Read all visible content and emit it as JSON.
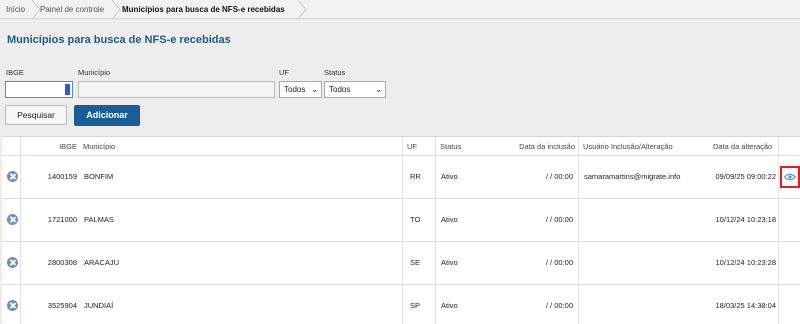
{
  "breadcrumb": {
    "items": [
      "Início",
      "Painel de controle",
      "Municípios para busca de NFS-e recebidas"
    ]
  },
  "page_title": "Municípios para busca de NFS-e recebidas",
  "filters": {
    "ibge_label": "IBGE",
    "ibge_value": "",
    "municipio_label": "Município",
    "municipio_value": "",
    "uf_label": "UF",
    "uf_selected": "Todos",
    "status_label": "Status",
    "status_selected": "Todos"
  },
  "actions": {
    "search_label": "Pesquisar",
    "add_label": "Adicionar"
  },
  "table": {
    "headers": {
      "ibge": "IBGE",
      "municipio": "Município",
      "uf": "UF",
      "status": "Status",
      "inclusao": "Data da inclusão",
      "usuario": "Usuário Inclusão/Alteração",
      "alteracao": "Data da alteração"
    },
    "rows": [
      {
        "ibge": "1400159",
        "municipio": "BONFIM",
        "uf": "RR",
        "status": "Ativo",
        "inclusao": "/ / 00:00",
        "usuario": "samaramartins@migrate.info",
        "alteracao": "09/09/25 09:00:22"
      },
      {
        "ibge": "1721000",
        "municipio": "PALMAS",
        "uf": "TO",
        "status": "Ativo",
        "inclusao": "/ / 00:00",
        "usuario": "",
        "alteracao": "10/12/24 10:23:18"
      },
      {
        "ibge": "2800308",
        "municipio": "ARACAJU",
        "uf": "SE",
        "status": "Ativo",
        "inclusao": "/ / 00:00",
        "usuario": "",
        "alteracao": "10/12/24 10:23:28"
      },
      {
        "ibge": "3525904",
        "municipio": "JUNDIAÍ",
        "uf": "SP",
        "status": "Ativo",
        "inclusao": "/ / 00:00",
        "usuario": "",
        "alteracao": "18/03/25 14:38:04"
      }
    ]
  },
  "icons": {
    "delete": "remove-circle-icon",
    "view": "eye-icon"
  },
  "colors": {
    "title": "#1d5b88",
    "primary_button": "#1b5e97",
    "highlight": "#e02020"
  }
}
